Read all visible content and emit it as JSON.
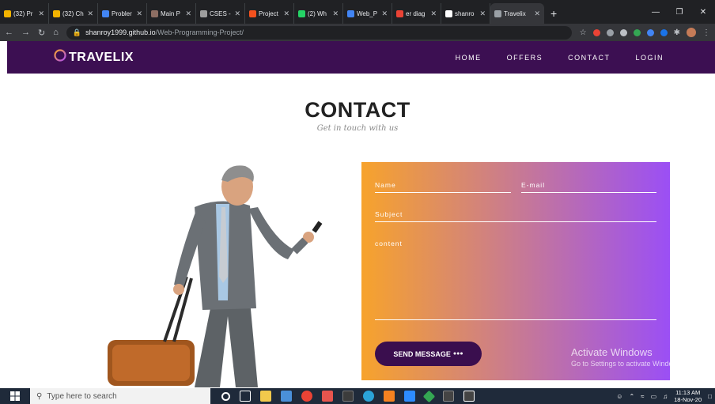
{
  "browser": {
    "tabs": [
      {
        "title": "(32) Pr",
        "color": "#f4b400"
      },
      {
        "title": "(32) Ch",
        "color": "#f4b400"
      },
      {
        "title": "Probler",
        "color": "#4285f4"
      },
      {
        "title": "Main P",
        "color": "#8d6e63"
      },
      {
        "title": "CSES -",
        "color": "#9e9e9e"
      },
      {
        "title": "Project",
        "color": "#f4511e"
      },
      {
        "title": "(2) Wh",
        "color": "#25d366"
      },
      {
        "title": "Web_P",
        "color": "#4285f4"
      },
      {
        "title": "er diag",
        "color": "#ea4335"
      },
      {
        "title": "shanro",
        "color": "#ffffff"
      },
      {
        "title": "Travelix",
        "color": "#9aa0a6",
        "active": true
      }
    ],
    "url_host": "shanroy1999.github.io",
    "url_path": "/Web-Programming-Project/"
  },
  "site": {
    "brand": "TRAVELIX",
    "nav": [
      "HOME",
      "OFFERS",
      "CONTACT",
      "LOGIN"
    ]
  },
  "contact": {
    "title": "CONTACT",
    "subtitle": "Get in touch with us",
    "name_placeholder": "Name",
    "email_placeholder": "E-mail",
    "subject_placeholder": "Subject",
    "content_placeholder": "content",
    "send_label": "SEND MESSAGE",
    "send_dots": "●●●"
  },
  "watermark": {
    "line1": "Activate Windows",
    "line2": "Go to Settings to activate Windows."
  },
  "taskbar": {
    "search_placeholder": "Type here to search",
    "time": "11:13 AM",
    "date": "18-Nov-20"
  }
}
